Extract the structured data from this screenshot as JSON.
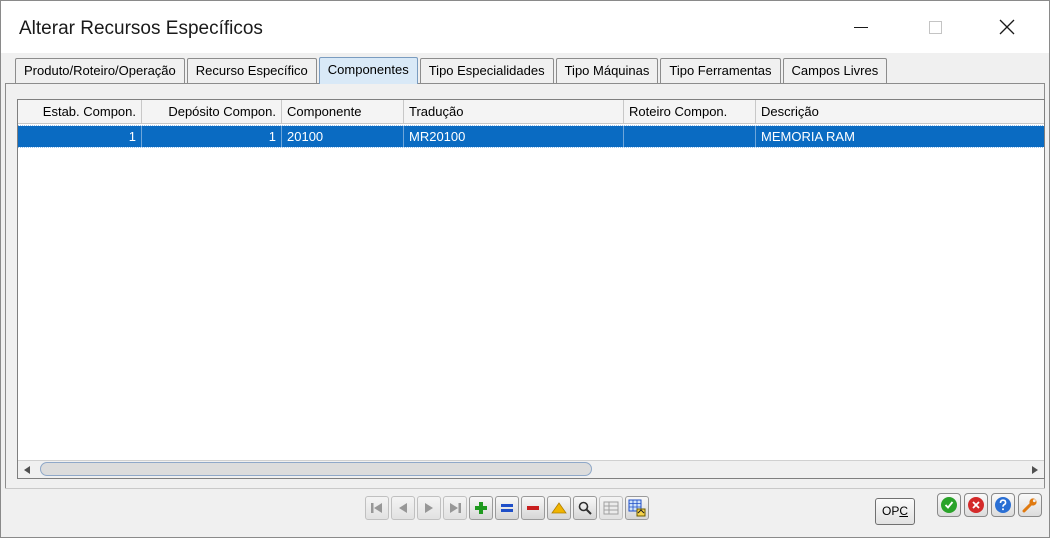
{
  "window": {
    "title": "Alterar Recursos Específicos"
  },
  "tabs": [
    {
      "label": "Produto/Roteiro/Operação",
      "active": false
    },
    {
      "label": "Recurso Específico",
      "active": false
    },
    {
      "label": "Componentes",
      "active": true
    },
    {
      "label": "Tipo Especialidades",
      "active": false
    },
    {
      "label": "Tipo Máquinas",
      "active": false
    },
    {
      "label": "Tipo Ferramentas",
      "active": false
    },
    {
      "label": "Campos Livres",
      "active": false
    }
  ],
  "grid": {
    "columns": [
      "Estab. Compon.",
      "Depósito Compon.",
      "Componente",
      "Tradução",
      "Roteiro Compon.",
      "Descrição"
    ],
    "rows": [
      [
        "1",
        "1",
        "20100",
        "MR20100",
        "",
        "MEMORIA RAM"
      ]
    ]
  },
  "toolbar": {
    "opc_prefix": "OP",
    "opc_underlined": "C"
  },
  "colors": {
    "selection": "#0a6bc2",
    "active_tab": "#d9e9f7",
    "ok_green": "#2aa32a",
    "cancel_red": "#d42a2a",
    "help_blue": "#2a6fd4",
    "tool_orange": "#e07a10"
  }
}
